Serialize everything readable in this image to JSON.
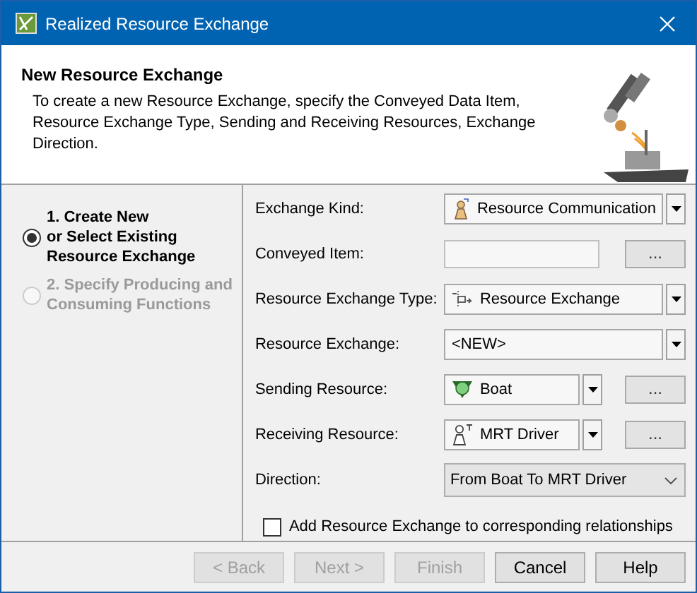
{
  "window": {
    "title": "Realized Resource Exchange"
  },
  "header": {
    "title": "New Resource Exchange",
    "description": "To create a new Resource Exchange, specify the Conveyed Data Item, Resource Exchange Type, Sending and Receiving Resources, Exchange Direction."
  },
  "steps": [
    {
      "label": "1. Create New\nor Select Existing\nResource Exchange",
      "selected": true,
      "disabled": false
    },
    {
      "label": "2. Specify Producing and\nConsuming Functions",
      "selected": false,
      "disabled": true
    }
  ],
  "fields": [
    {
      "label": "Exchange Kind:",
      "kind": "combo",
      "value": "Resource Communication"
    },
    {
      "label": "Conveyed Item:",
      "kind": "text",
      "more_button": "..."
    },
    {
      "label": "Resource Exchange Type:",
      "kind": "combo",
      "value": "Resource Exchange"
    },
    {
      "label": "Resource Exchange:",
      "kind": "combo",
      "value": "<NEW>"
    },
    {
      "label": "Sending Resource:",
      "kind": "combo",
      "value": "Boat",
      "more_button": "..."
    },
    {
      "label": "Receiving Resource:",
      "kind": "combo",
      "value": "MRT Driver",
      "more_button": "..."
    },
    {
      "label": "Direction:",
      "kind": "select",
      "value": "From Boat To MRT Driver"
    }
  ],
  "checkbox": {
    "label": "Add Resource Exchange to corresponding relationships",
    "checked": false
  },
  "buttons": [
    {
      "label": "< Back",
      "disabled": true
    },
    {
      "label": "Next >",
      "disabled": true
    },
    {
      "label": "Finish",
      "disabled": true
    },
    {
      "label": "Cancel",
      "disabled": false
    },
    {
      "label": "Help",
      "disabled": false
    }
  ]
}
